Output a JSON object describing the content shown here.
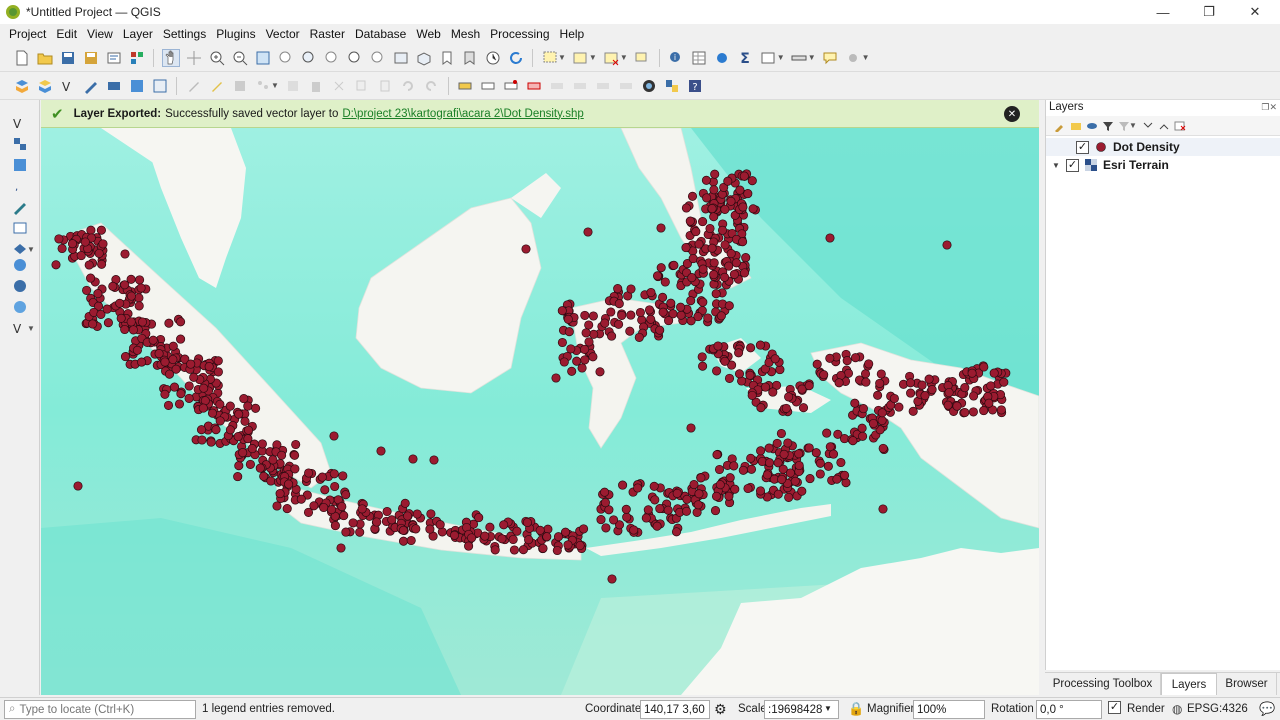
{
  "window": {
    "title": "*Untitled Project — QGIS",
    "min": "—",
    "max": "❐",
    "close": "✕"
  },
  "menu": [
    "Project",
    "Edit",
    "View",
    "Layer",
    "Settings",
    "Plugins",
    "Vector",
    "Raster",
    "Database",
    "Web",
    "Mesh",
    "Processing",
    "Help"
  ],
  "message": {
    "title": "Layer Exported:",
    "text": "Successfully saved vector layer to",
    "link": "D:\\project 23\\kartografi\\acara 2\\Dot Density.shp"
  },
  "layers_panel": {
    "title": "Layers",
    "items": [
      {
        "name": "Dot Density",
        "checked": true
      },
      {
        "name": "Esri Terrain",
        "checked": true,
        "expanded": true
      }
    ]
  },
  "dot_color": "#9b1b30",
  "tabs": [
    "Processing Toolbox",
    "Layers",
    "Browser"
  ],
  "active_tab": "Layers",
  "status": {
    "locator_placeholder": "Type to locate (Ctrl+K)",
    "message": "1 legend entries removed.",
    "coordinate_label": "Coordinate",
    "coordinate": "140,17 3,60",
    "scale_label": "Scale",
    "scale": ":19698428",
    "magnifier_label": "Magnifier",
    "magnifier": "100%",
    "rotation_label": "Rotation",
    "rotation": "0,0 °",
    "render_label": "Render",
    "crs": "EPSG:4326"
  }
}
